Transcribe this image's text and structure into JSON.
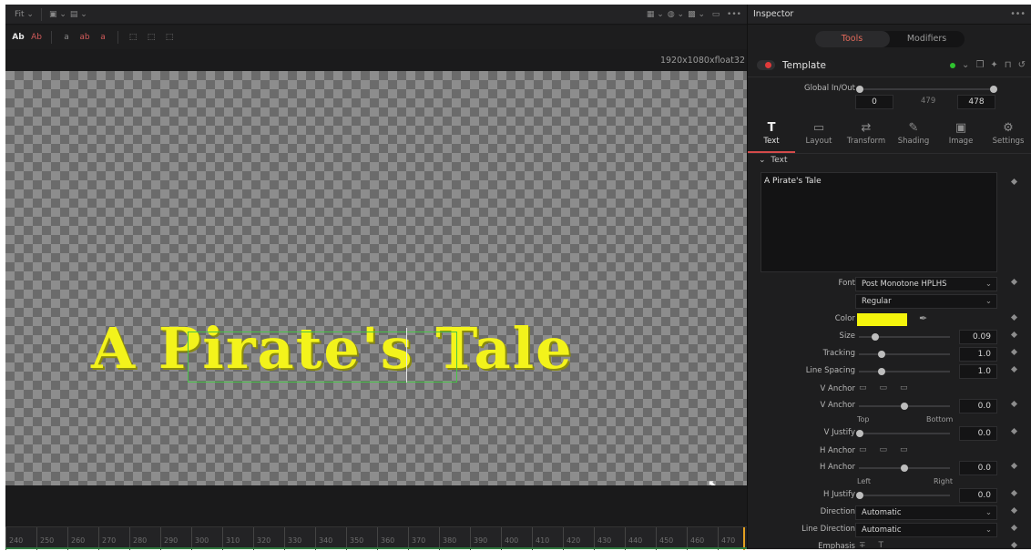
{
  "viewer": {
    "zoom": "Fit",
    "resolution": "1920x1080xfloat32",
    "title_text": "A Pirate's Tale",
    "ruler": [
      "240",
      "250",
      "260",
      "270",
      "280",
      "290",
      "300",
      "310",
      "320",
      "330",
      "340",
      "350",
      "360",
      "370",
      "380",
      "390",
      "400",
      "410",
      "420",
      "430",
      "440",
      "450",
      "460",
      "470"
    ]
  },
  "inspector": {
    "header": "Inspector",
    "seg_tools": "Tools",
    "seg_modifiers": "Modifiers",
    "node_name": "Template",
    "global_label": "Global In/Out",
    "global_in": "0",
    "global_mid": "479",
    "global_out": "478",
    "tabs": [
      {
        "label": "Text",
        "icon": "T"
      },
      {
        "label": "Layout",
        "icon": "▭"
      },
      {
        "label": "Transform",
        "icon": "⇄"
      },
      {
        "label": "Shading",
        "icon": "✎"
      },
      {
        "label": "Image",
        "icon": "▣"
      },
      {
        "label": "Settings",
        "icon": "⚙"
      }
    ],
    "section": "Text",
    "styled_text": "A Pirate's Tale",
    "font_label": "Font",
    "font_value": "Post Monotone HPLHS",
    "style_value": "Regular",
    "color_label": "Color",
    "color_value": "#f4f40c",
    "size_label": "Size",
    "size_value": "0.09",
    "tracking_label": "Tracking",
    "tracking_value": "1.0",
    "linespacing_label": "Line Spacing",
    "linespacing_value": "1.0",
    "vanchor_label": "V Anchor",
    "vanchor2_label": "V Anchor",
    "vanchor2_value": "0.0",
    "top_label": "Top",
    "bottom_label": "Bottom",
    "vjustify_label": "V Justify",
    "vjustify_value": "0.0",
    "hanchor_label": "H Anchor",
    "hanchor2_label": "H Anchor",
    "hanchor2_value": "0.0",
    "left_label": "Left",
    "right_label": "Right",
    "hjustify_label": "H Justify",
    "hjustify_value": "0.0",
    "direction_label": "Direction",
    "direction_value": "Automatic",
    "linedirection_label": "Line Direction",
    "linedirection_value": "Automatic",
    "emphasis_label": "Emphasis"
  }
}
